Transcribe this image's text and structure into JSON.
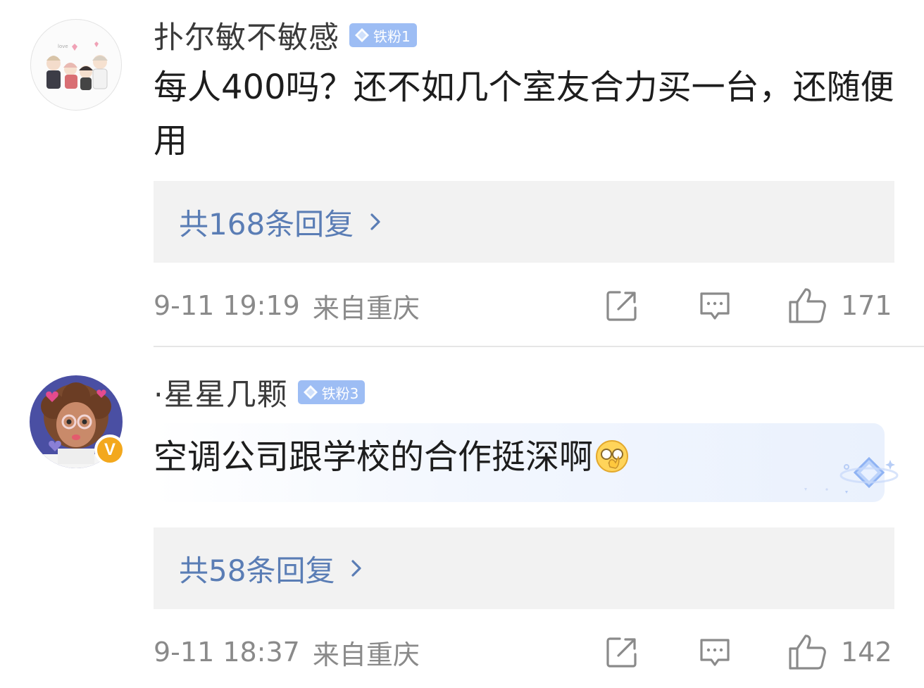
{
  "comments": [
    {
      "username": "扑尔敏不敏感",
      "fan_badge": "铁粉1",
      "content": "每人400吗？还不如几个室友合力买一台，还随便用",
      "replies_label": "共168条回复",
      "time": "9-11 19:19",
      "location": "来自重庆",
      "likes": "171",
      "verified": false
    },
    {
      "username": "·星星几颗",
      "fan_badge": "铁粉3",
      "content": "空调公司跟学校的合作挺深啊",
      "replies_label": "共58条回复",
      "time": "9-11 18:37",
      "location": "来自重庆",
      "likes": "142",
      "verified": true,
      "verified_mark": "V"
    }
  ],
  "colors": {
    "reply_link": "#5a7db5",
    "fan_badge_bg": "#9dbdf4",
    "meta_text": "#8a8a8a",
    "reply_box_bg": "#f2f2f2",
    "verified_badge": "#f3a81d"
  },
  "icons": {
    "share": "share-icon",
    "comment": "comment-icon",
    "like": "thumbs-up-icon",
    "chevron": "chevron-right-icon",
    "diamond": "diamond-icon",
    "emoji": "facepalm-emoji-icon"
  }
}
